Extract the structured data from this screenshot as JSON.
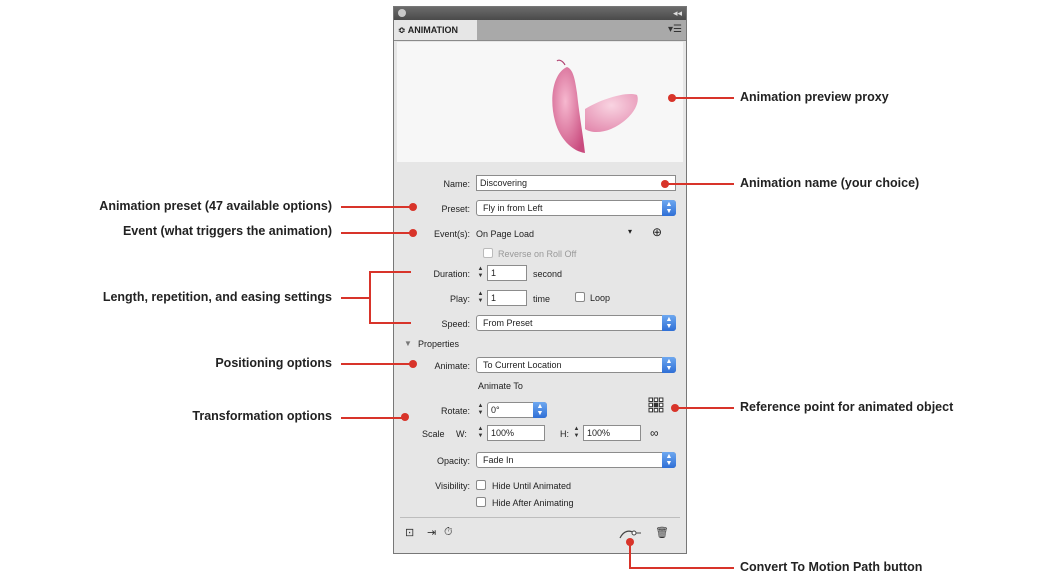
{
  "panel": {
    "tab_label": "≎ ANIMATION",
    "menu_icon": "panel-menu-icon",
    "collapse_icon": "collapse-icon",
    "name_label": "Name:",
    "name_value": "Discovering",
    "preset_label": "Preset:",
    "preset_value": "Fly in from Left",
    "events_label": "Event(s):",
    "events_value": "On Page Load",
    "reverse_label": "Reverse on Roll Off",
    "duration_label": "Duration:",
    "duration_value": "1",
    "duration_unit": "second",
    "play_label": "Play:",
    "play_value": "1",
    "play_unit": "time",
    "loop_label": "Loop",
    "speed_label": "Speed:",
    "speed_value": "From Preset",
    "properties_label": "Properties",
    "animate_label": "Animate:",
    "animate_value": "To Current Location",
    "animate_to_label": "Animate To",
    "rotate_label": "Rotate:",
    "rotate_value": "0°",
    "scale_label": "Scale",
    "w_label": "W:",
    "w_value": "100%",
    "h_label": "H:",
    "h_value": "100%",
    "opacity_label": "Opacity:",
    "opacity_value": "Fade In",
    "visibility_label": "Visibility:",
    "hide_until_label": "Hide Until Animated",
    "hide_after_label": "Hide After Animating"
  },
  "callouts": {
    "preview_proxy": "Animation preview proxy",
    "name": "Animation name (your choice)",
    "preset": "Animation preset (47 available options)",
    "event": "Event (what triggers the animation)",
    "length": "Length, repetition, and easing settings",
    "positioning": "Positioning options",
    "transformation": "Transformation options",
    "reference_point": "Reference point for animated object",
    "motion_path": "Convert To Motion Path button"
  },
  "colors": {
    "callout_red": "#d8342a",
    "select_blue": "#2f6fd6",
    "butterfly_pink": "#e07ba4"
  }
}
